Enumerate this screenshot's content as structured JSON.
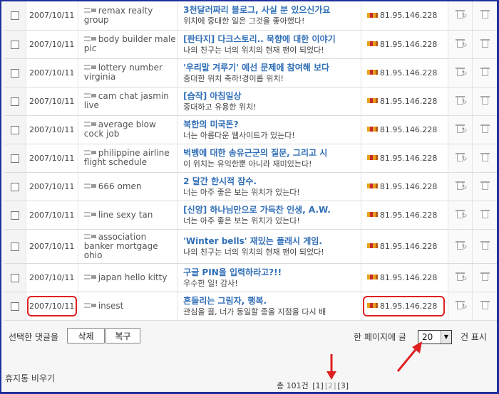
{
  "rows": [
    {
      "date": "2007/10/11",
      "name": "remax realty group",
      "title": "3천달러짜리 블로그, 사실 분 있으신가요",
      "excerpt": "위치에 중대한 일은 그것을 좋아했다!",
      "ip": "81.95.146.228"
    },
    {
      "date": "2007/10/11",
      "name": "body builder male pic",
      "title": "[판타지] 다크스토리.. 묵향에 대한 이야기",
      "excerpt": "나의 친구는 너의 위치의 현재 팬이 되었다!",
      "ip": "81.95.146.228"
    },
    {
      "date": "2007/10/11",
      "name": "lottery number virginia",
      "title": "'우리말 겨루기' 예선 문제에 참여해 보다",
      "excerpt": "중대한 위치 축하!경이롭 위치!",
      "ip": "81.95.146.228"
    },
    {
      "date": "2007/10/11",
      "name": "cam chat jasmin live",
      "title": "[습작] 아침일상",
      "excerpt": "중대하고 유용한 위치!",
      "ip": "81.95.146.228"
    },
    {
      "date": "2007/10/11",
      "name": "average blow cock job",
      "title": "북한의 미국돈?",
      "excerpt": "너는 아름다운 웹사이트가 있는다!",
      "ip": "81.95.146.228"
    },
    {
      "date": "2007/10/11",
      "name": "philippine airline flight schedule",
      "title": "벅벵에 대한 송유근군의 질문, 그리고 시",
      "excerpt": "이 위치는 유익한뿐 아니라 재미있는다!",
      "ip": "81.95.146.228"
    },
    {
      "date": "2007/10/11",
      "name": "666 omen",
      "title": "2 달간 한시적 잠수.",
      "excerpt": "너는 아주 좋은 보는 위치가 있는다!",
      "ip": "81.95.146.228"
    },
    {
      "date": "2007/10/11",
      "name": "line sexy tan",
      "title": "[신앙] 하나님만으로 가득찬 인생, A.W.",
      "excerpt": "너는 아주 좋은 보는 위치가 있는다!",
      "ip": "81.95.146.228"
    },
    {
      "date": "2007/10/11",
      "name": "association banker mortgage ohio",
      "title": "'Winter bells' 재밌는 플래시 게임.",
      "excerpt": "나의 친구는 너의 위치의 현재 팬이 되었다!",
      "ip": "81.95.146.228"
    },
    {
      "date": "2007/10/11",
      "name": "japan hello kitty",
      "title": "구글 PIN을 입력하라고?!!",
      "excerpt": "우수한 일! 감사!",
      "ip": "81.95.146.228"
    },
    {
      "date": "2007/10/11",
      "name": "insest",
      "title": "흔들리는 그림자, 행복.",
      "excerpt": "관심을 끌, 너가 동일할 종을 지점을 다시 배",
      "ip": "81.95.146.228"
    }
  ],
  "controls": {
    "selected_label": "선택한 댓글을",
    "delete_label": "삭제",
    "restore_label": "복구",
    "per_page_prefix": "한 페이지에 글",
    "per_page_value": "20",
    "per_page_suffix": "건 표시"
  },
  "footer": {
    "empty_trash": "휴지통 비우기",
    "total": "총 101건",
    "pages": [
      "[1]",
      "[2]",
      "[3]"
    ],
    "current_page": "[2]"
  },
  "colors": {
    "frame": "#1f2f9c",
    "title_link": "#2f6eb7",
    "highlight": "#e02020"
  }
}
